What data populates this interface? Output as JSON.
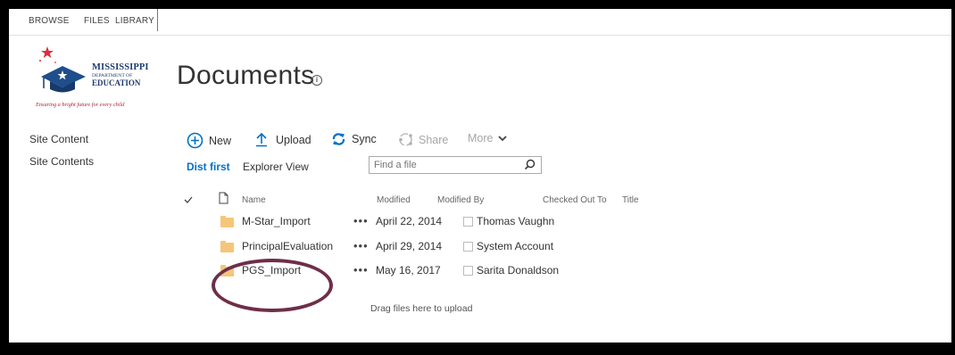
{
  "ribbon": {
    "tabs": [
      "BROWSE",
      "FILES",
      "LIBRARY"
    ]
  },
  "logo": {
    "line1": "MISSISSIPPI",
    "line2": "DEPARTMENT OF",
    "line3": "EDUCATION",
    "tagline": "Ensuring a bright future for every child"
  },
  "page": {
    "title": "Documents"
  },
  "nav": {
    "items": [
      "Site Content",
      "Site Contents"
    ]
  },
  "commands": {
    "new": "New",
    "upload": "Upload",
    "sync": "Sync",
    "share": "Share",
    "more": "More"
  },
  "views": {
    "current": "Dist first",
    "explorer": "Explorer View"
  },
  "search": {
    "placeholder": "Find a file"
  },
  "columns": {
    "name": "Name",
    "modified": "Modified",
    "modified_by": "Modified By",
    "checked_out_to": "Checked Out To",
    "title": "Title"
  },
  "rows": [
    {
      "name": "M-Star_Import",
      "modified": "April 22, 2014",
      "modified_by": "Thomas Vaughn"
    },
    {
      "name": "PrincipalEvaluation",
      "modified": "April 29, 2014",
      "modified_by": "System Account"
    },
    {
      "name": "PGS_Import",
      "modified": "May 16, 2017",
      "modified_by": "Sarita Donaldson"
    }
  ],
  "drag_hint": "Drag files here to upload",
  "colors": {
    "accent": "#0072c6",
    "folder": "#f5c67a",
    "highlight_circle": "#6e2e48",
    "logo_blue": "#1f3b70",
    "logo_red": "#b22234"
  }
}
